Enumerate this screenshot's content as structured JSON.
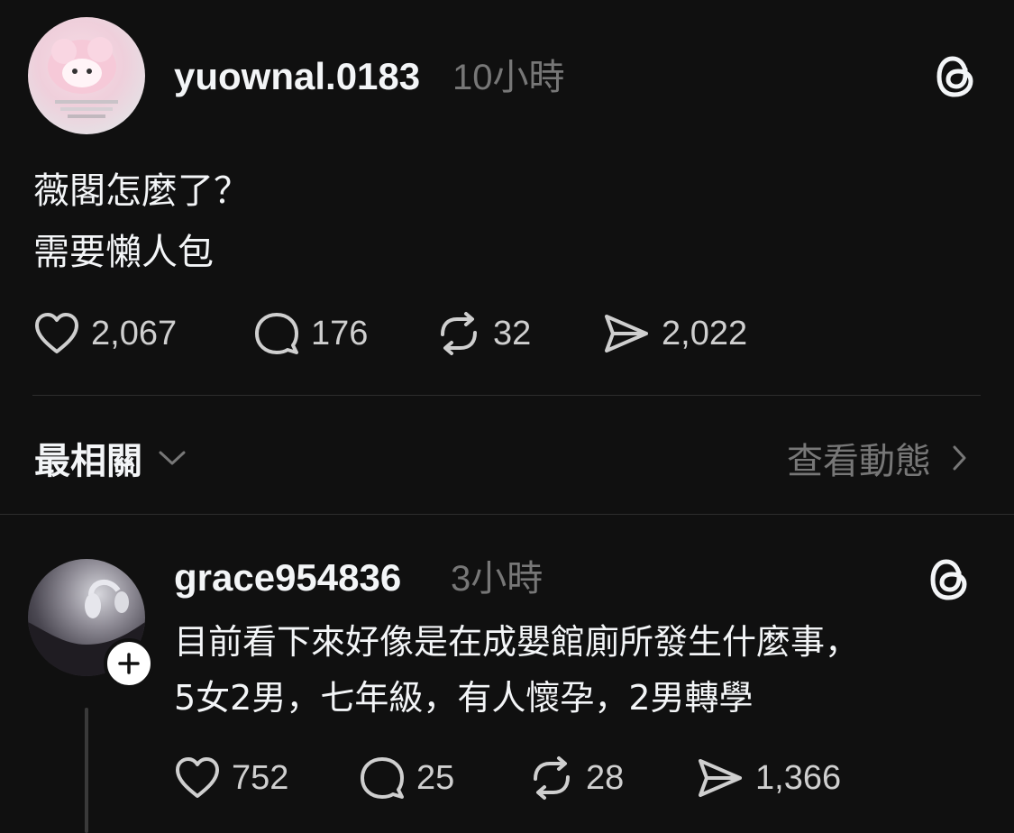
{
  "post": {
    "username": "yuownal.0183",
    "time": "10小時",
    "text_lines": [
      "薇閣怎麼了？",
      "需要懶人包"
    ],
    "likes": "2,067",
    "replies": "176",
    "reposts": "32",
    "shares": "2,022"
  },
  "filter": {
    "sort_label": "最相關",
    "view_activity_label": "查看動態"
  },
  "reply": {
    "username": "grace954836",
    "time": "3小時",
    "text_lines": [
      "目前看下來好像是在成嬰館廁所發生什麼事，",
      "5女2男，七年級，有人懷孕，2男轉學"
    ],
    "likes": "752",
    "replies": "25",
    "reposts": "28",
    "shares": "1,366"
  },
  "icons": {
    "threads_logo": "threads-logo-icon",
    "like": "heart-icon",
    "reply": "speech-bubble-icon",
    "repost": "repost-arrows-icon",
    "share": "send-icon",
    "sort_chevron": "chevron-down-icon",
    "activity_chevron": "chevron-right-icon",
    "follow": "plus-icon"
  },
  "colors": {
    "background": "#101010",
    "primary_text": "#f3f5f7",
    "secondary_text": "#777777",
    "divider": "#2d2d2d"
  }
}
